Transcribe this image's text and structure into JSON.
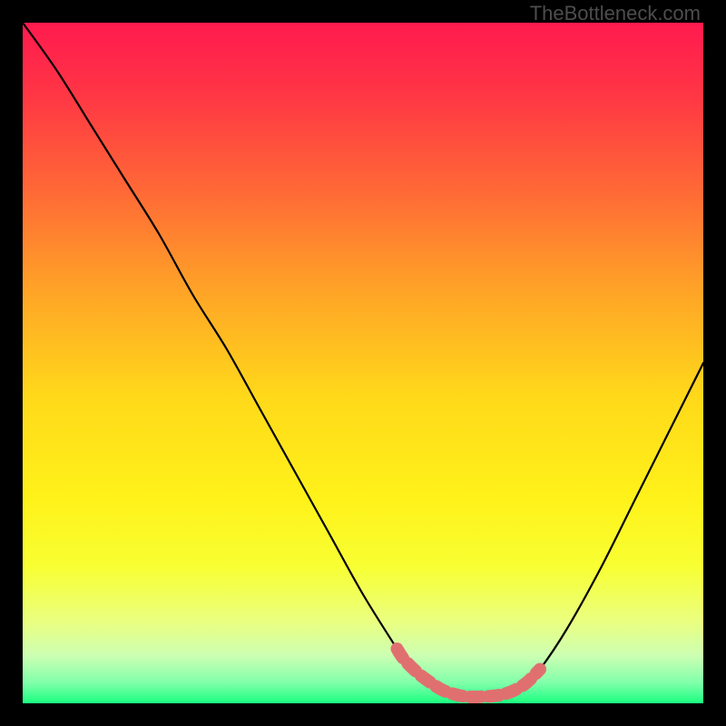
{
  "watermark": "TheBottleneck.com",
  "chart_data": {
    "type": "line",
    "title": "",
    "xlabel": "",
    "ylabel": "",
    "xlim": [
      0,
      100
    ],
    "ylim": [
      0,
      100
    ],
    "series": [
      {
        "name": "main-curve",
        "color": "#000000",
        "x": [
          0,
          5,
          10,
          15,
          20,
          25,
          30,
          35,
          40,
          45,
          50,
          55,
          56,
          58,
          60,
          62,
          65,
          68,
          70,
          72,
          74,
          76,
          80,
          85,
          90,
          95,
          100
        ],
        "y": [
          100,
          93,
          85,
          77,
          69,
          60,
          52,
          43,
          34,
          25,
          16,
          8,
          6.5,
          4.5,
          3,
          1.8,
          1.0,
          1.0,
          1.2,
          1.8,
          3.0,
          5.0,
          11,
          20,
          30,
          40,
          50
        ]
      },
      {
        "name": "bottleneck-highlight",
        "color": "#e07070",
        "x": [
          55,
          56,
          58,
          60,
          62,
          65,
          68,
          70,
          72,
          74,
          76
        ],
        "y": [
          8,
          6.5,
          4.5,
          3,
          1.8,
          1.0,
          1.0,
          1.2,
          1.8,
          3.0,
          5.0
        ]
      }
    ],
    "gradient_stops": [
      {
        "offset": 0.0,
        "color": "#ff1a4f"
      },
      {
        "offset": 0.1,
        "color": "#ff3445"
      },
      {
        "offset": 0.25,
        "color": "#ff6a36"
      },
      {
        "offset": 0.4,
        "color": "#ffa626"
      },
      {
        "offset": 0.55,
        "color": "#ffd91a"
      },
      {
        "offset": 0.7,
        "color": "#fff21a"
      },
      {
        "offset": 0.8,
        "color": "#f8ff33"
      },
      {
        "offset": 0.88,
        "color": "#eaff80"
      },
      {
        "offset": 0.93,
        "color": "#ccffb3"
      },
      {
        "offset": 0.97,
        "color": "#80ffaa"
      },
      {
        "offset": 1.0,
        "color": "#1aff80"
      }
    ]
  }
}
